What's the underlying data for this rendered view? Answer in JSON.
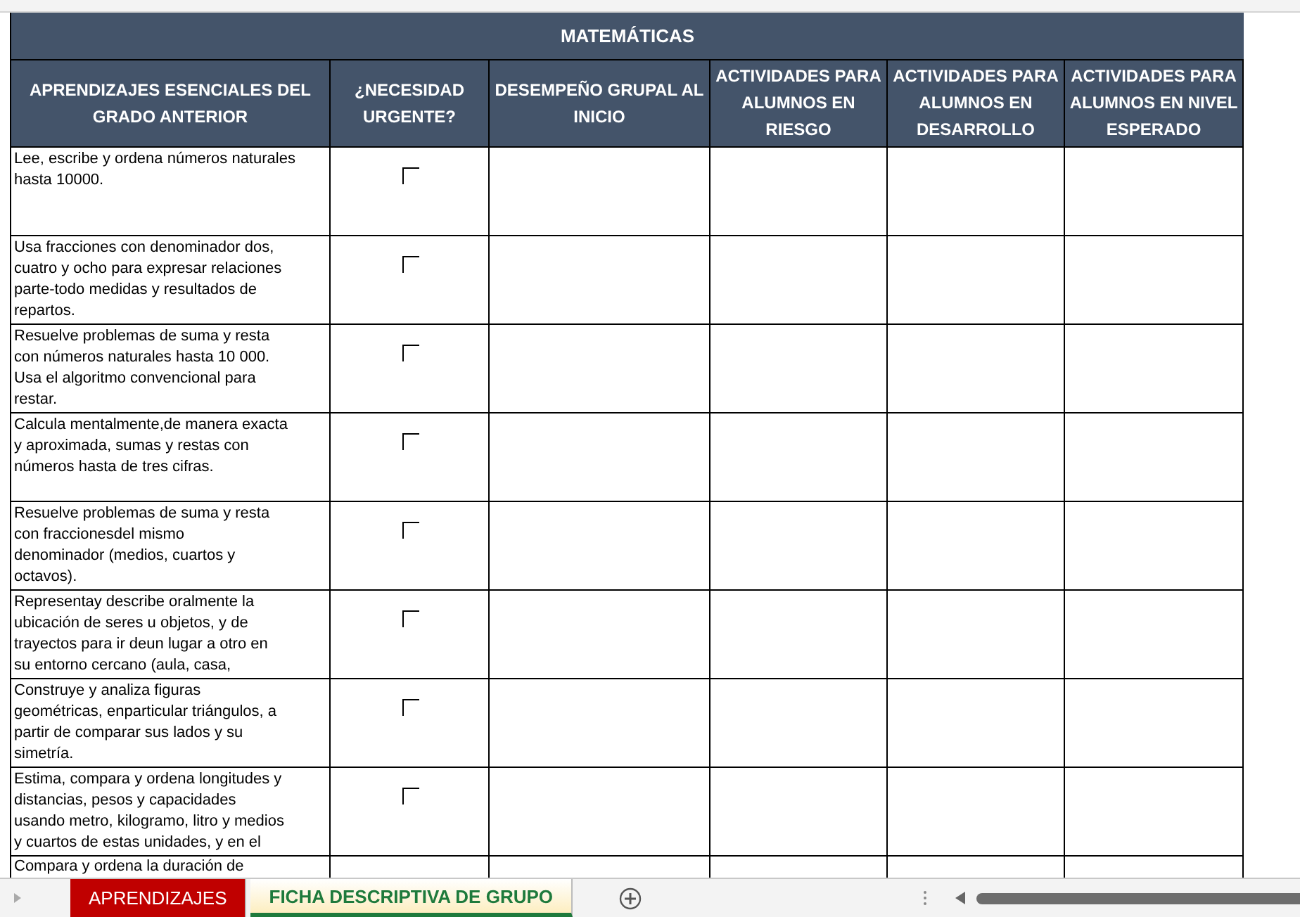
{
  "sheet": {
    "title": "MATEMÁTICAS",
    "columns": [
      "APRENDIZAJES ESENCIALES DEL GRADO ANTERIOR",
      "¿NECESIDAD URGENTE?",
      "DESEMPEÑO GRUPAL AL INICIO",
      "ACTIVIDADES PARA ALUMNOS EN RIESGO",
      "ACTIVIDADES PARA ALUMNOS EN DESARROLLO",
      "ACTIVIDADES PARA ALUMNOS EN NIVEL ESPERADO"
    ],
    "rows": [
      {
        "lines": [
          "Lee, escribe y ordena números naturales",
          "hasta 10000."
        ],
        "urgent": false
      },
      {
        "lines": [
          "Usa fracciones con denominador dos,",
          "cuatro y ocho para expresar relaciones",
          "parte-todo medidas y resultados de",
          "repartos."
        ],
        "urgent": false
      },
      {
        "lines": [
          "Resuelve problemas de suma y resta",
          "con números naturales hasta 10 000.",
          "Usa el algoritmo convencional para",
          "restar."
        ],
        "urgent": false
      },
      {
        "lines": [
          "Calcula mentalmente,de manera exacta",
          "y aproximada, sumas y restas con",
          "números hasta de tres cifras."
        ],
        "urgent": false
      },
      {
        "lines": [
          "Resuelve problemas de suma y resta",
          "con fraccionesdel mismo",
          "denominador (medios, cuartos y",
          "octavos)."
        ],
        "urgent": false
      },
      {
        "lines": [
          "Representay describe oralmente la",
          "ubicación de seres u objetos, y de",
          "trayectos para ir deun lugar a otro en",
          "su entorno cercano (aula, casa,"
        ],
        "urgent": false
      },
      {
        "lines": [
          "Construye y analiza figuras",
          "geométricas, enparticular triángulos, a",
          "partir de comparar sus lados y su",
          "simetría."
        ],
        "urgent": false
      },
      {
        "lines": [
          "Estima, compara y ordena longitudes y",
          "distancias, pesos y capacidades",
          "usando metro, kilogramo, litro y medios",
          "y cuartos de estas unidades, y en el"
        ],
        "urgent": false
      },
      {
        "lines": [
          "Compara y ordena la duración de"
        ],
        "urgent": null
      }
    ]
  },
  "sheet_tabs": [
    {
      "label": "APRENDIZAJES",
      "selected": false,
      "color": "#c00000"
    },
    {
      "label": "FICHA DESCRIPTIVA DE GRUPO",
      "selected": true,
      "color": "#1e7a3c"
    }
  ]
}
